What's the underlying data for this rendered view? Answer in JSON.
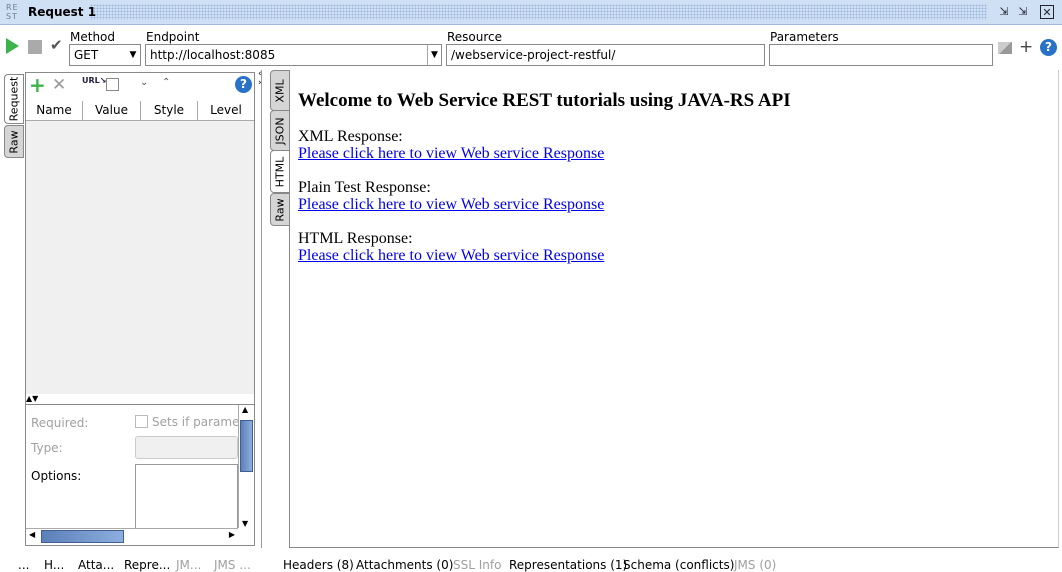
{
  "window": {
    "logo": "RE ST",
    "title": "Request 1",
    "buttons": [
      "restore-icon",
      "minimize-icon",
      "close-icon"
    ]
  },
  "toolbar": {
    "method_label": "Method",
    "method_value": "GET",
    "endpoint_label": "Endpoint",
    "endpoint_value": "http://localhost:8085",
    "resource_label": "Resource",
    "resource_value": "/webservice-project-restful/",
    "parameters_label": "Parameters",
    "parameters_value": ""
  },
  "request": {
    "tabs": [
      "Request",
      "Raw"
    ],
    "columns": [
      "Name",
      "Value",
      "Style",
      "Level"
    ],
    "form": {
      "required": "Required:",
      "sets_if": "Sets if parameter",
      "type": "Type:",
      "options": "Options:"
    },
    "bottom_tabs": [
      "...",
      "H...",
      "Atta...",
      "Repre...",
      "JM...",
      "JMS ..."
    ]
  },
  "response": {
    "tabs": [
      "XML",
      "JSON",
      "HTML",
      "Raw"
    ],
    "active_tab": "HTML",
    "heading": "Welcome to Web Service REST tutorials using JAVA-RS API",
    "sections": [
      {
        "label": "XML Response:",
        "link": "Please click here to view Web service Response"
      },
      {
        "label": "Plain Test Response:",
        "link": "Please click here to view Web service Response"
      },
      {
        "label": "HTML Response:",
        "link": "Please click here to view Web service Response"
      }
    ],
    "bottom_tabs": [
      {
        "label": "Headers (8)",
        "enabled": true
      },
      {
        "label": "Attachments (0)",
        "enabled": true
      },
      {
        "label": "SSL Info",
        "enabled": false
      },
      {
        "label": "Representations (1)",
        "enabled": true
      },
      {
        "label": "Schema (conflicts)",
        "enabled": true
      },
      {
        "label": "JMS (0)",
        "enabled": false
      }
    ]
  },
  "colors": {
    "titlebar": "#cfe0f5",
    "link": "#0000ee",
    "run": "#3cb44b",
    "help": "#2a72c8"
  }
}
